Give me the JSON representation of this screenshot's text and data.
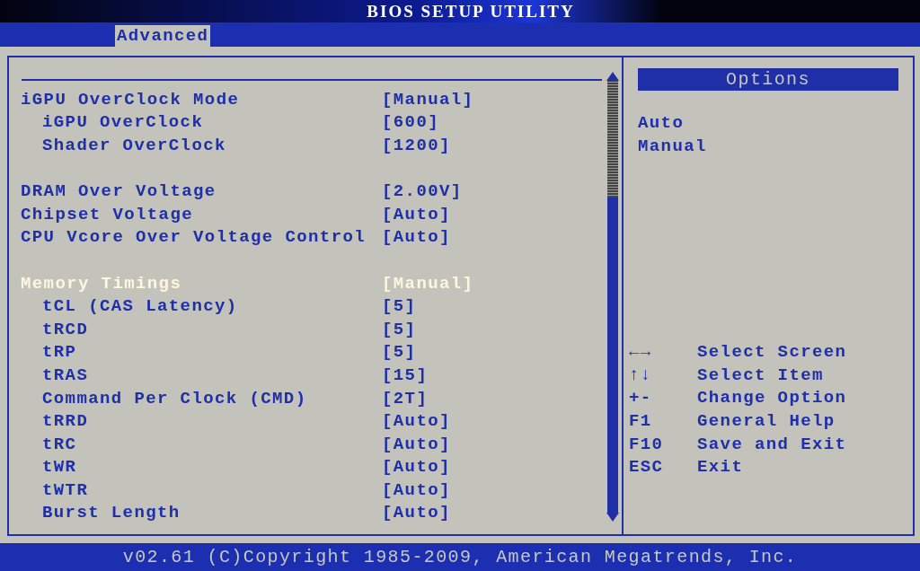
{
  "window": {
    "title": "BIOS SETUP UTILITY"
  },
  "tabs": [
    {
      "label": "Advanced",
      "selected": true
    }
  ],
  "settings": {
    "groups": [
      [
        {
          "label": "iGPU OverClock Mode",
          "value": "[Manual]",
          "selected": false,
          "children": [
            {
              "label": "iGPU OverClock",
              "value": "[600]",
              "selected": false
            },
            {
              "label": "Shader OverClock",
              "value": "[1200]",
              "selected": false
            }
          ]
        }
      ],
      [
        {
          "label": "DRAM Over Voltage",
          "value": "[2.00V]",
          "selected": false
        },
        {
          "label": "Chipset Voltage",
          "value": "[Auto]",
          "selected": false
        },
        {
          "label": "CPU Vcore Over Voltage Control",
          "value": "[Auto]",
          "selected": false
        }
      ],
      [
        {
          "label": "Memory Timings",
          "value": "[Manual]",
          "selected": true,
          "children": [
            {
              "label": "tCL (CAS Latency)",
              "value": "[5]",
              "selected": false
            },
            {
              "label": "tRCD",
              "value": "[5]",
              "selected": false
            },
            {
              "label": "tRP",
              "value": "[5]",
              "selected": false
            },
            {
              "label": "tRAS",
              "value": "[15]",
              "selected": false
            },
            {
              "label": "Command Per Clock (CMD)",
              "value": "[2T]",
              "selected": false
            },
            {
              "label": "tRRD",
              "value": "[Auto]",
              "selected": false
            },
            {
              "label": "tRC",
              "value": "[Auto]",
              "selected": false
            },
            {
              "label": "tWR",
              "value": "[Auto]",
              "selected": false
            },
            {
              "label": "tWTR",
              "value": "[Auto]",
              "selected": false
            },
            {
              "label": "Burst Length",
              "value": "[Auto]",
              "selected": false
            }
          ]
        }
      ]
    ]
  },
  "options": {
    "title": "Options",
    "items": [
      "Auto",
      "Manual"
    ]
  },
  "key_help": [
    {
      "key": "←→",
      "action": "Select Screen"
    },
    {
      "key": "↑↓",
      "action": "Select Item"
    },
    {
      "key": "+-",
      "action": "Change Option"
    },
    {
      "key": "F1",
      "action": "General Help"
    },
    {
      "key": "F10",
      "action": "Save and Exit"
    },
    {
      "key": "ESC",
      "action": "Exit"
    }
  ],
  "status_bar": {
    "text": "v02.61 (C)Copyright 1985-2009, American Megatrends, Inc."
  }
}
